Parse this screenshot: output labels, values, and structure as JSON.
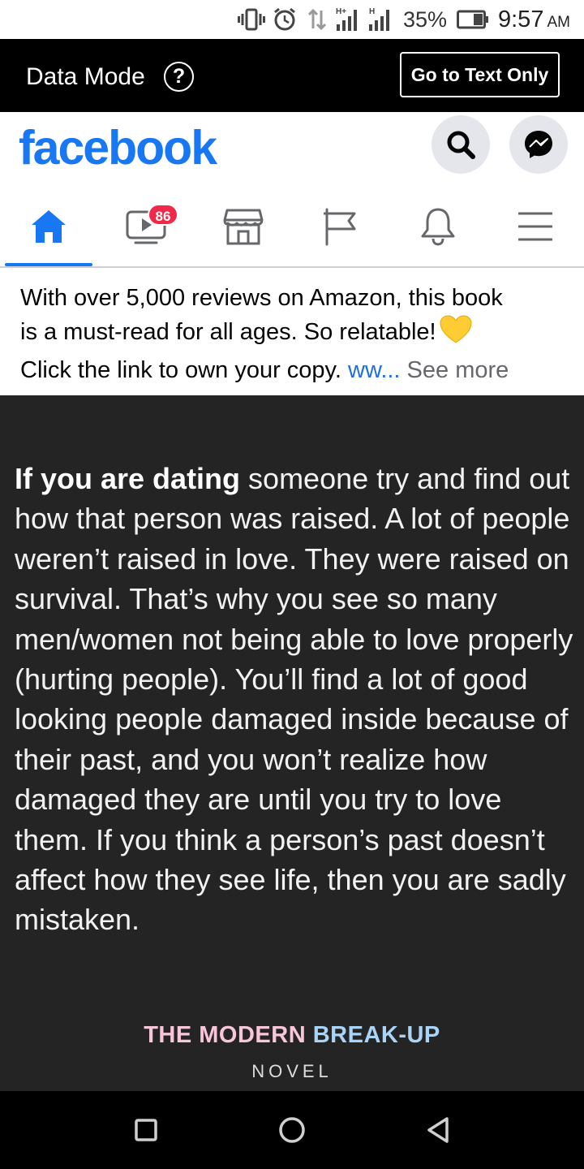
{
  "status_bar": {
    "battery": "35%",
    "time": "9:57",
    "ampm": "AM",
    "network_label": "H+",
    "network_label_2": "H"
  },
  "data_bar": {
    "title": "Data Mode",
    "help_symbol": "?",
    "text_only_button": "Go to Text Only"
  },
  "header": {
    "logo": "facebook",
    "accent": "#1877F2"
  },
  "nav": {
    "tabs": [
      {
        "name": "home",
        "icon": "home-icon",
        "active": true
      },
      {
        "name": "watch",
        "icon": "video-icon",
        "badge": "86"
      },
      {
        "name": "marketplace",
        "icon": "store-icon"
      },
      {
        "name": "pages",
        "icon": "flag-icon"
      },
      {
        "name": "notifications",
        "icon": "bell-icon"
      },
      {
        "name": "menu",
        "icon": "menu-icon"
      }
    ]
  },
  "post": {
    "line1": "With over 5,000 reviews on Amazon, this book",
    "line2": "is a must-read for all ages. So relatable!",
    "line3": "Click the link to own your copy. ",
    "link_text": "ww...",
    "see_more": " See more",
    "heart": "yellow-heart-icon"
  },
  "image": {
    "quote_bold": "If you are dating",
    "quote_rest": " someone try and find out how that person was raised. A lot of people weren’t raised in love. They were raised on survival.  That’s why you see so many men/women not being able to love properly (hurting people). You’ll find a lot of good looking people damaged inside because of their past, and you won’t realize how damaged they are until you try to love them.  If you think a person’s past doesn’t affect how they see life, then you are sadly mistaken.",
    "book_part1": "THE MODERN ",
    "book_part2": "BREAK-UP",
    "book_sub": "NOVEL",
    "background": "#242424"
  }
}
